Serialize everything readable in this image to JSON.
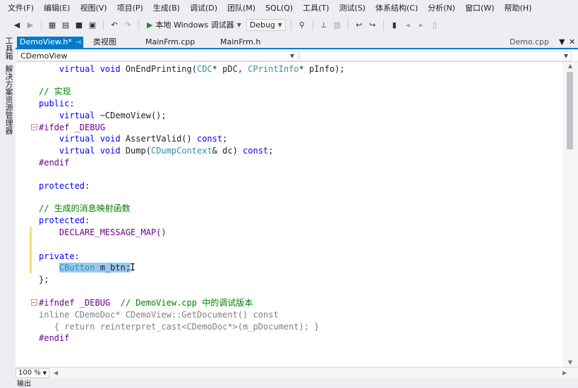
{
  "menu": [
    "文件(F)",
    "编辑(E)",
    "视图(V)",
    "项目(P)",
    "生成(B)",
    "调试(D)",
    "团队(M)",
    "SQL(Q)",
    "工具(T)",
    "测试(S)",
    "体系结构(C)",
    "分析(N)",
    "窗口(W)",
    "帮助(H)"
  ],
  "toolbar": {
    "run_label": "本地 Windows 调试器",
    "config_value": "Debug"
  },
  "left_strip": {
    "toolbox_label": "工具箱",
    "solution_label": "解决方案资源管理器"
  },
  "tabs": {
    "active": "DemoView.h*",
    "class_view": "类视图",
    "mainfrm_cpp": "MainFrm.cpp",
    "mainfrm_h": "MainFrm.h",
    "demo_cpp": "Demo.cpp"
  },
  "nav": {
    "class_combo": "CDemoView"
  },
  "code": {
    "l1_kw": "virtual void",
    "l1_rest": " OnEndPrinting(",
    "l1_t1": "CDC",
    "l1_mid": "* pDC, ",
    "l1_t2": "CPrintInfo",
    "l1_end": "* pInfo);",
    "l2": "// 实现",
    "l3": "public:",
    "l4_kw": "virtual",
    "l4_rest": " ~CDemoView();",
    "l5": "#ifdef _DEBUG",
    "l6_kw": "virtual void",
    "l6_rest": " AssertValid() ",
    "l6_const": "const",
    "l6_end": ";",
    "l7_kw": "virtual void",
    "l7_rest": " Dump(",
    "l7_t": "CDumpContext",
    "l7_mid": "& dc) ",
    "l7_const": "const",
    "l7_end": ";",
    "l8": "#endif",
    "l9": "protected:",
    "l10": "// 生成的消息映射函数",
    "l11": "protected:",
    "l12": "DECLARE_MESSAGE_MAP()",
    "l13": "private:",
    "l14_t": "CButton",
    "l14_rest": " m_btn;",
    "l15": "};",
    "l16_pp": "#ifndef _DEBUG",
    "l16_cm": "  // DemoView.cpp 中的调试版本",
    "l17_kw": "inline",
    "l17_rest": " CDemoDoc* CDemoView::GetDocument() ",
    "l17_const": "const",
    "l18_open": "{ ",
    "l18_kw": "return reinterpret_cast",
    "l18_rest": "<CDemoDoc*>(m_pDocument); }",
    "l19": "#endif"
  },
  "status": {
    "zoom": "100 %",
    "output_label": "输出"
  },
  "colors": {
    "accent": "#007acc",
    "keyword": "#0000ff",
    "type": "#2b91af",
    "comment": "#008000",
    "selection": "#99c9ef"
  }
}
